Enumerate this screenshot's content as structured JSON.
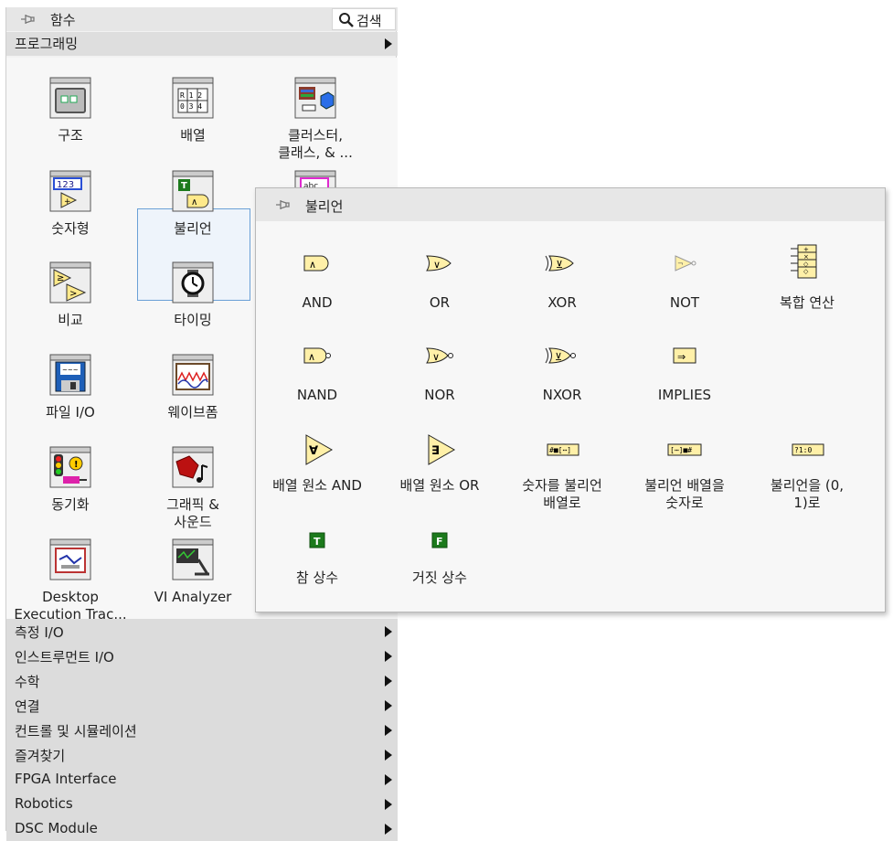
{
  "palette": {
    "title": "함수",
    "search_label": "검색",
    "category": "프로그래밍",
    "tiles": [
      {
        "label": "구조",
        "icon": "structures-icon"
      },
      {
        "label": "배열",
        "icon": "array-icon"
      },
      {
        "label": "클러스터,\n클래스, & ...",
        "icon": "cluster-class-icon"
      },
      {
        "label": "숫자형",
        "icon": "numeric-icon"
      },
      {
        "label": "불리언",
        "icon": "boolean-icon"
      },
      {
        "label": "",
        "icon": "string-icon"
      },
      {
        "label": "비교",
        "icon": "comparison-icon"
      },
      {
        "label": "타이밍",
        "icon": "timing-icon"
      },
      {
        "label": "파일 I/O",
        "icon": "file-io-icon"
      },
      {
        "label": "웨이브폼",
        "icon": "waveform-icon"
      },
      {
        "label": "동기화",
        "icon": "synchronization-icon"
      },
      {
        "label": "그래픽 &\n사운드",
        "icon": "graphics-sound-icon"
      },
      {
        "label": "Desktop\nExecution Trac...",
        "icon": "desktop-execution-trace-icon"
      },
      {
        "label": "VI Analyzer",
        "icon": "vi-analyzer-icon"
      }
    ],
    "categories": [
      "측정 I/O",
      "인스트루먼트 I/O",
      "수학",
      "연결",
      "컨트롤 및 시뮬레이션",
      "즐겨찾기",
      "FPGA Interface",
      "Robotics",
      "DSC Module"
    ]
  },
  "boolean_palette": {
    "title": "불리언",
    "items": [
      {
        "label": "AND",
        "icon": "and-icon"
      },
      {
        "label": "OR",
        "icon": "or-icon"
      },
      {
        "label": "XOR",
        "icon": "xor-icon"
      },
      {
        "label": "NOT",
        "icon": "not-icon"
      },
      {
        "label": "복합 연산",
        "icon": "compound-arithmetic-icon"
      },
      {
        "label": "NAND",
        "icon": "nand-icon"
      },
      {
        "label": "NOR",
        "icon": "nor-icon"
      },
      {
        "label": "NXOR",
        "icon": "nxor-icon"
      },
      {
        "label": "IMPLIES",
        "icon": "implies-icon"
      },
      {
        "label": "배열 원소 AND",
        "icon": "and-array-elements-icon"
      },
      {
        "label": "배열 원소 OR",
        "icon": "or-array-elements-icon"
      },
      {
        "label": "숫자를 불리언\n배열로",
        "icon": "number-to-boolean-array-icon"
      },
      {
        "label": "불리언 배열을\n숫자로",
        "icon": "boolean-array-to-number-icon"
      },
      {
        "label": "불리언을 (0,\n1)로",
        "icon": "boolean-to-01-icon"
      },
      {
        "label": "참 상수",
        "icon": "true-constant-icon"
      },
      {
        "label": "거짓 상수",
        "icon": "false-constant-icon"
      }
    ]
  }
}
